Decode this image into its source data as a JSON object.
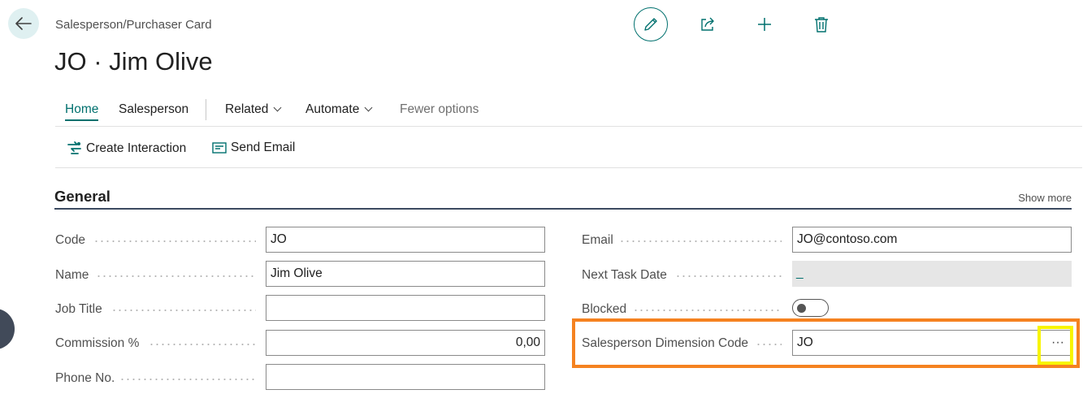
{
  "header": {
    "breadcrumb": "Salesperson/Purchaser Card",
    "title": "JO · Jim Olive"
  },
  "top_actions": [
    {
      "name": "edit-icon",
      "label": "Edit"
    },
    {
      "name": "share-icon",
      "label": "Share"
    },
    {
      "name": "plus-icon",
      "label": "New"
    },
    {
      "name": "trash-icon",
      "label": "Delete"
    }
  ],
  "tabs": {
    "home": "Home",
    "salesperson": "Salesperson",
    "related": "Related",
    "automate": "Automate",
    "fewer": "Fewer options"
  },
  "actions": {
    "create_interaction": "Create Interaction",
    "send_email": "Send Email"
  },
  "section": {
    "title": "General",
    "show_more": "Show more"
  },
  "fields": {
    "code": {
      "label": "Code",
      "value": "JO"
    },
    "name": {
      "label": "Name",
      "value": "Jim Olive"
    },
    "job_title": {
      "label": "Job Title",
      "value": ""
    },
    "commission": {
      "label": "Commission %",
      "value": "0,00"
    },
    "phone": {
      "label": "Phone No.",
      "value": ""
    },
    "email": {
      "label": "Email",
      "value": "JO@contoso.com"
    },
    "next_task_date": {
      "label": "Next Task Date",
      "value": "_"
    },
    "blocked": {
      "label": "Blocked",
      "value": "off"
    },
    "dimension_code": {
      "label": "Salesperson Dimension Code",
      "value": "JO",
      "lookup_label": "···"
    }
  },
  "colors": {
    "accent": "#00706e",
    "highlight_orange": "#f58220",
    "highlight_yellow": "#f8f400"
  }
}
